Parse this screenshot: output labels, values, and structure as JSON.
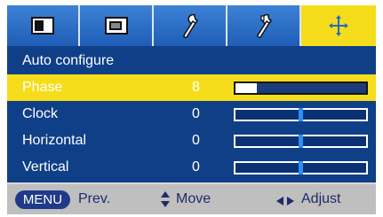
{
  "tabs": [
    {
      "name": "picture-tab",
      "icon": "monitor-icon",
      "active": false
    },
    {
      "name": "screen-tab",
      "icon": "screen-icon",
      "active": false
    },
    {
      "name": "settings-tab",
      "icon": "wrench-icon",
      "active": false
    },
    {
      "name": "options-tab",
      "icon": "tools-icon",
      "active": false
    },
    {
      "name": "position-tab",
      "icon": "position-cross-icon",
      "active": true
    }
  ],
  "menu": {
    "title": "Auto configure",
    "items": [
      {
        "label": "Phase",
        "value": "8",
        "level": 0.16,
        "selected": true,
        "type": "fill"
      },
      {
        "label": "Clock",
        "value": "0",
        "level": 0.5,
        "selected": false,
        "type": "center"
      },
      {
        "label": "Horizontal",
        "value": "0",
        "level": 0.5,
        "selected": false,
        "type": "center"
      },
      {
        "label": "Vertical",
        "value": "0",
        "level": 0.5,
        "selected": false,
        "type": "center"
      }
    ]
  },
  "footer": {
    "menu_key": "MENU",
    "prev_label": "Prev.",
    "move_label": "Move",
    "adjust_label": "Adjust"
  },
  "colors": {
    "tab_blue": "#2f6fc9",
    "highlight": "#f6dd1c",
    "panel_blue": "#0f3f87",
    "footer_gray": "#bfbfbf"
  }
}
